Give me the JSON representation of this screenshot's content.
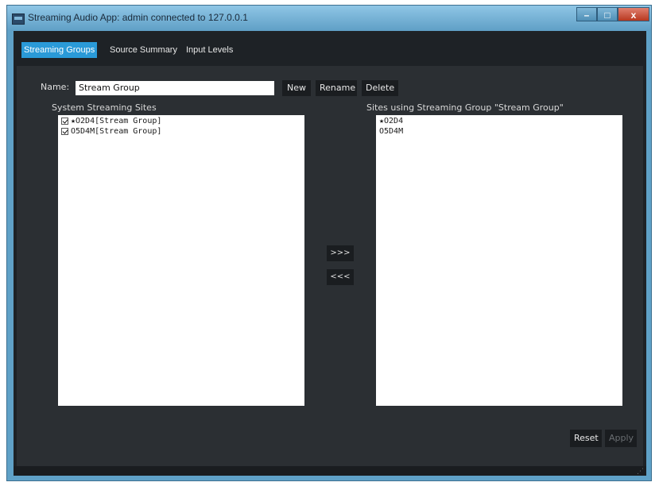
{
  "window": {
    "title": "Streaming Audio App: admin connected to 127.0.0.1",
    "controls": {
      "minimize": "–",
      "maximize": "□",
      "close": "x"
    }
  },
  "tabs": [
    {
      "label": "Streaming Groups",
      "active": true
    },
    {
      "label": "Source Summary",
      "active": false
    },
    {
      "label": "Input Levels",
      "active": false
    }
  ],
  "name_field": {
    "label": "Name:",
    "value": "Stream Group"
  },
  "toolbar": {
    "new_label": "New",
    "rename_label": "Rename",
    "delete_label": "Delete"
  },
  "system_sites": {
    "header": "System Streaming Sites",
    "items": [
      {
        "label": "★O2D4[Stream Group]",
        "checked": true
      },
      {
        "label": "O5D4M[Stream Group]",
        "checked": true
      }
    ]
  },
  "group_sites": {
    "header": "Sites using Streaming Group \"Stream Group\"",
    "items": [
      {
        "label": "★O2D4"
      },
      {
        "label": "O5D4M"
      }
    ]
  },
  "transfer": {
    "add_label": ">>>",
    "remove_label": "<<<"
  },
  "footer": {
    "reset_label": "Reset",
    "apply_label": "Apply"
  },
  "colors": {
    "active_tab": "#2a9ad8",
    "panel_bg": "#2b2f33",
    "titlebar": "#7fb6d8"
  }
}
